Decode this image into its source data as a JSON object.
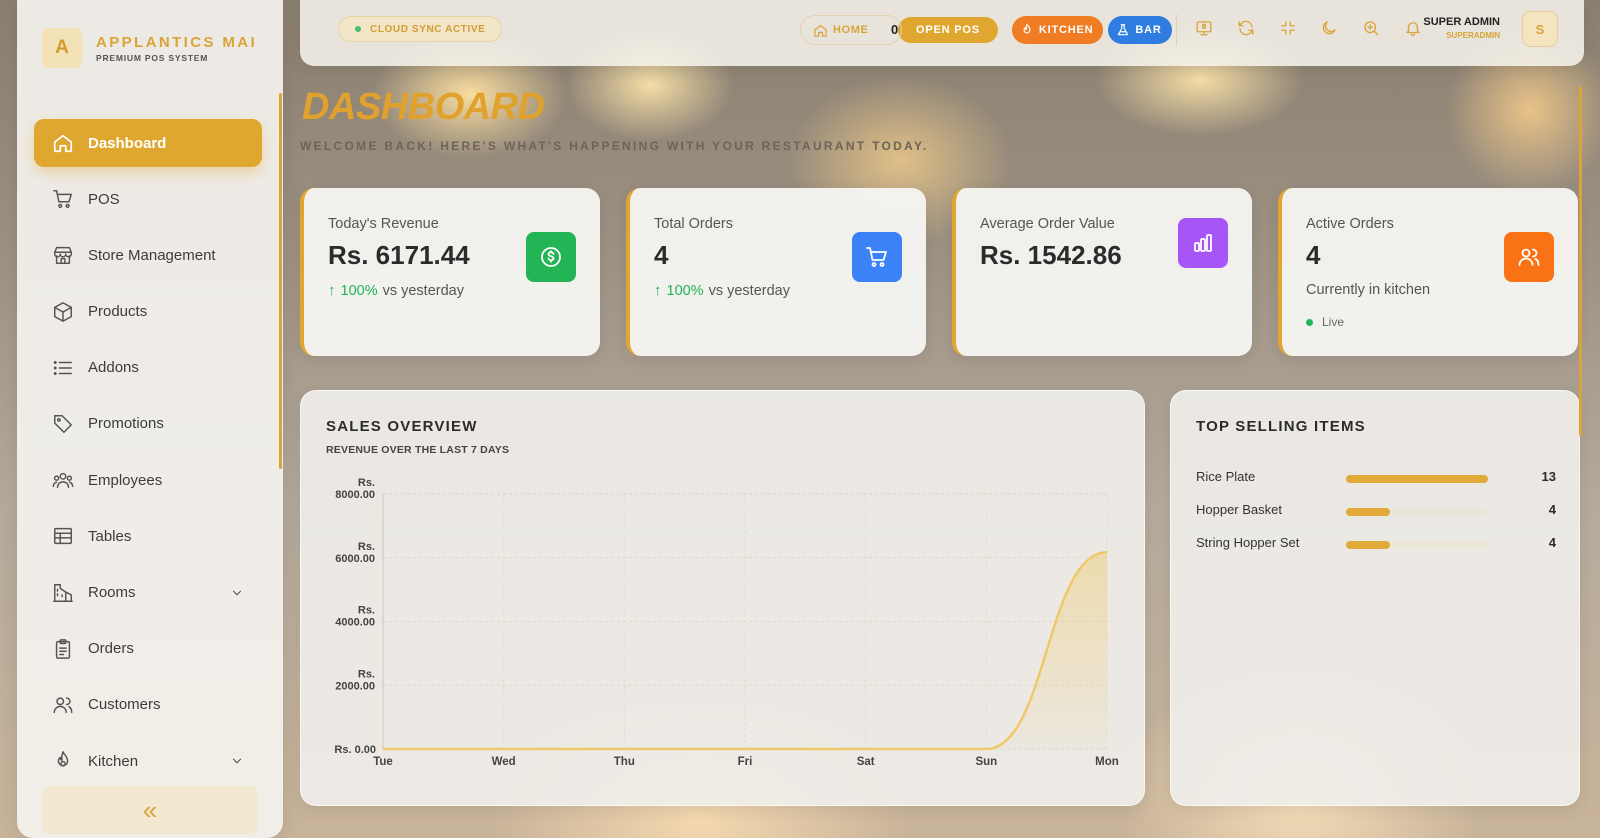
{
  "brand": {
    "logo_letter": "A",
    "name": "APPLANTICS MAI",
    "subtitle": "PREMIUM POS SYSTEM"
  },
  "sidebar": {
    "items": [
      {
        "label": "Dashboard",
        "icon": "home-icon",
        "active": true
      },
      {
        "label": "POS",
        "icon": "cart-icon"
      },
      {
        "label": "Store Management",
        "icon": "store-icon"
      },
      {
        "label": "Products",
        "icon": "box-icon"
      },
      {
        "label": "Addons",
        "icon": "list-icon"
      },
      {
        "label": "Promotions",
        "icon": "tag-icon"
      },
      {
        "label": "Employees",
        "icon": "users-icon"
      },
      {
        "label": "Tables",
        "icon": "table-icon"
      },
      {
        "label": "Rooms",
        "icon": "building-icon",
        "expandable": true
      },
      {
        "label": "Orders",
        "icon": "clipboard-icon"
      },
      {
        "label": "Customers",
        "icon": "customers-icon"
      },
      {
        "label": "Kitchen",
        "icon": "kitchen-icon",
        "expandable": true
      }
    ],
    "collapse_label": "«"
  },
  "topbar": {
    "sync_status": "CLOUD SYNC ACTIVE",
    "home_label": "HOME",
    "home_count": "0",
    "open_pos": "OPEN POS",
    "kitchen": "KITCHEN",
    "bar": "BAR",
    "icons": [
      "receipt-icon",
      "refresh-icon",
      "fullscreen-icon",
      "moon-icon",
      "zoom-icon",
      "bell-icon"
    ],
    "user_name": "SUPER ADMIN",
    "user_role": "SUPERADMIN",
    "avatar_letter": "S"
  },
  "header": {
    "title": "DASHBOARD",
    "subtitle": "WELCOME BACK! HERE'S WHAT'S HAPPENING WITH YOUR RESTAURANT TODAY."
  },
  "stats": [
    {
      "label": "Today's Revenue",
      "value": "Rs. 6171.44",
      "change": "100%",
      "change_suffix": "vs yesterday",
      "icon": "dollar-icon",
      "color": "#22b455"
    },
    {
      "label": "Total Orders",
      "value": "4",
      "change": "100%",
      "change_suffix": "vs yesterday",
      "icon": "cart-icon",
      "color": "#3b82f6"
    },
    {
      "label": "Average Order Value",
      "value": "Rs. 1542.86",
      "icon": "chart-icon",
      "color": "#a855f7"
    },
    {
      "label": "Active Orders",
      "value": "4",
      "note": "Currently in kitchen",
      "live_label": "Live",
      "icon": "users-icon",
      "color": "#f97316"
    }
  ],
  "sales": {
    "title": "SALES OVERVIEW",
    "subtitle": "REVENUE OVER THE LAST 7 DAYS"
  },
  "chart_data": {
    "type": "area",
    "title": "SALES OVERVIEW",
    "subtitle": "REVENUE OVER THE LAST 7 DAYS",
    "categories": [
      "Tue",
      "Wed",
      "Thu",
      "Fri",
      "Sat",
      "Sun",
      "Mon"
    ],
    "values": [
      0,
      0,
      0,
      0,
      0,
      0,
      6171.44
    ],
    "ylim": [
      0,
      8000
    ],
    "y_ticks": [
      "Rs. 0.00",
      "Rs. 2000.00",
      "Rs. 4000.00",
      "Rs. 6000.00",
      "Rs. 8000.00"
    ],
    "y_tick_values": [
      0,
      2000,
      4000,
      6000,
      8000
    ],
    "line_color": "#efc86a",
    "grid": true
  },
  "top_selling": {
    "title": "TOP SELLING ITEMS",
    "max": 13,
    "items": [
      {
        "name": "Rice Plate",
        "count": 13
      },
      {
        "name": "Hopper Basket",
        "count": 4
      },
      {
        "name": "String Hopper Set",
        "count": 4
      }
    ]
  }
}
